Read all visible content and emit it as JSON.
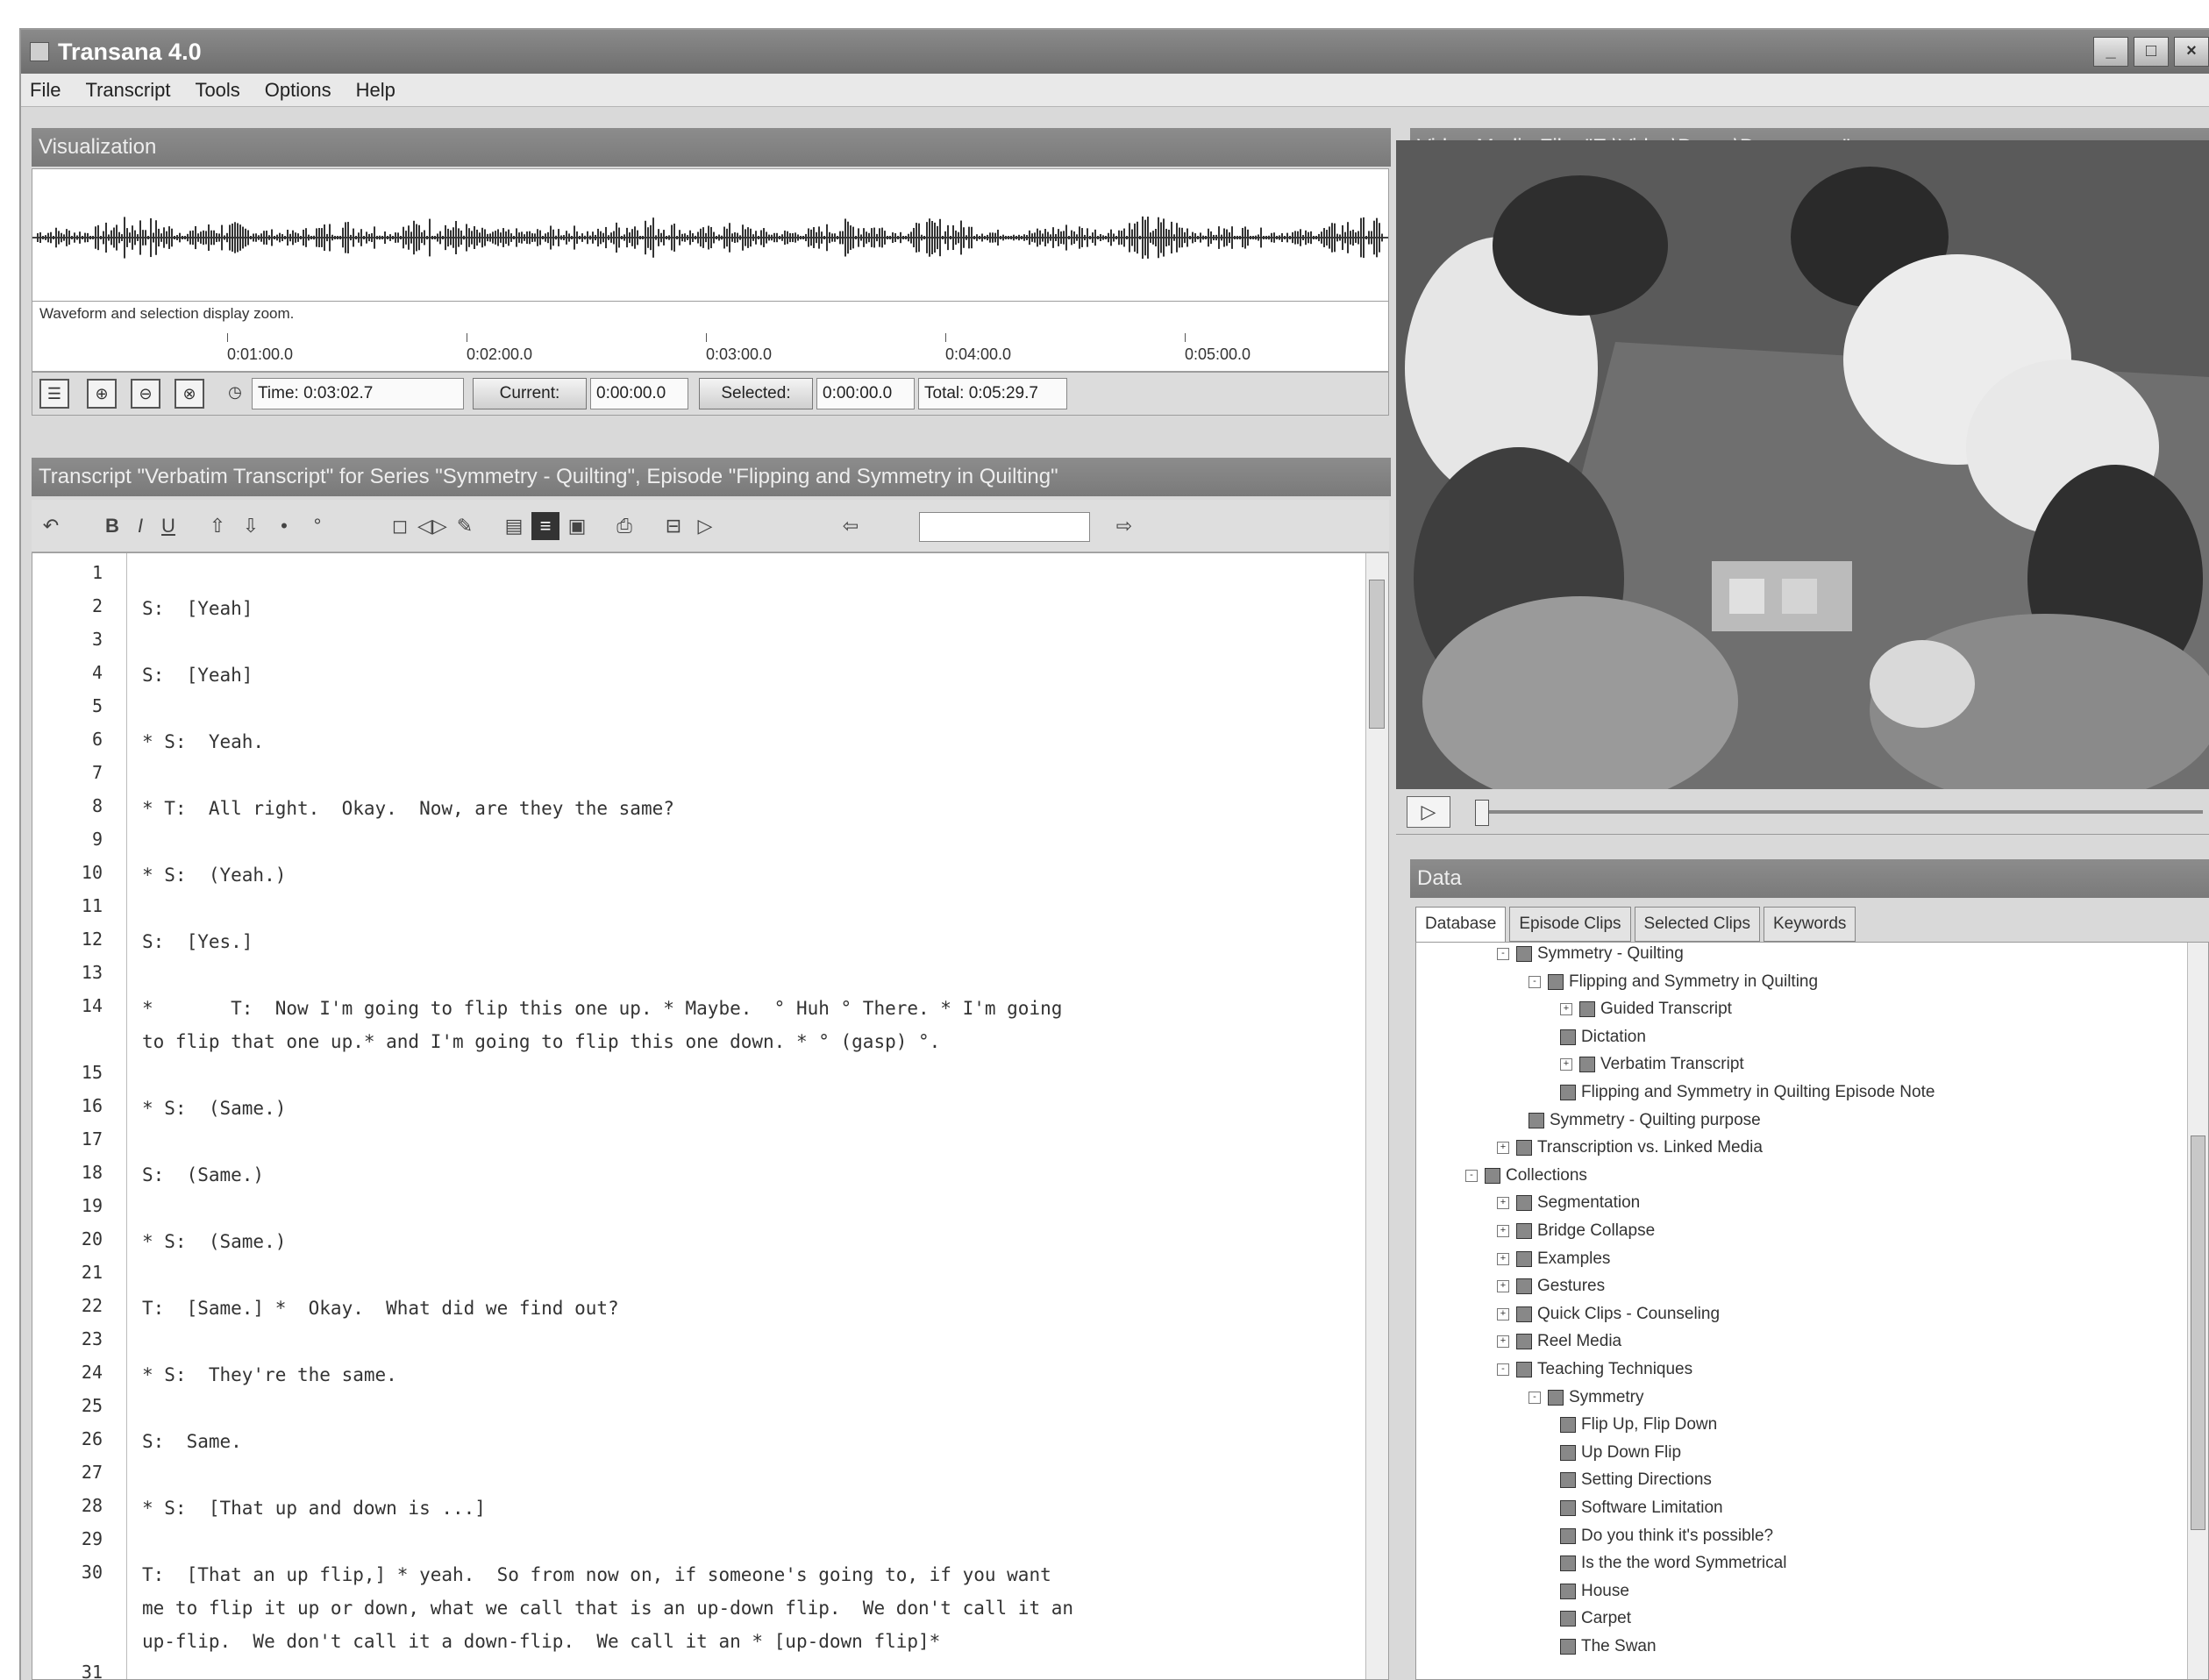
{
  "window": {
    "title": "Transana 4.0",
    "controls": [
      "_",
      "□",
      "×"
    ]
  },
  "menu": [
    "File",
    "Transcript",
    "Tools",
    "Options",
    "Help"
  ],
  "visualization": {
    "header": "Visualization",
    "caption": "Waveform and selection display zoom.",
    "ticks": [
      "0:01:00.0",
      "0:02:00.0",
      "0:03:00.0",
      "0:04:00.0",
      "0:05:00.0"
    ],
    "time_label": "Time: 0:03:02.7",
    "current_label": "Current:",
    "current_value": "0:00:00.0",
    "selected_label": "Selected:",
    "selected_value": "0:00:00.0",
    "total_label": "Total: 0:05:29.7"
  },
  "transcript": {
    "header": "Transcript \"Verbatim Transcript\" for Series \"Symmetry - Quilting\", Episode \"Flipping and Symmetry in Quilting\"",
    "toolbar_icons": [
      "undo-icon",
      "bold-icon",
      "italic-icon",
      "underline-icon",
      "rising-intonation-icon",
      "falling-intonation-icon",
      "audible-breath-icon",
      "whisper-icon",
      "timecode-icon",
      "toggle-timecodes-icon",
      "save-icon",
      "propagate-icon",
      "print-icon",
      "find-icon",
      "close-icon",
      "search-back-icon",
      "search-forward-icon"
    ],
    "lines": [
      {
        "n": "1",
        "t": ""
      },
      {
        "n": "2",
        "t": "S:  [Yeah]"
      },
      {
        "n": "3",
        "t": ""
      },
      {
        "n": "4",
        "t": "S:  [Yeah]"
      },
      {
        "n": "5",
        "t": ""
      },
      {
        "n": "6",
        "t": "* S:  Yeah."
      },
      {
        "n": "7",
        "t": ""
      },
      {
        "n": "8",
        "t": "* T:  All right.  Okay.  Now, are they the same?"
      },
      {
        "n": "9",
        "t": ""
      },
      {
        "n": "10",
        "t": "* S:  (Yeah.)"
      },
      {
        "n": "11",
        "t": ""
      },
      {
        "n": "12",
        "t": "S:  [Yes.]"
      },
      {
        "n": "13",
        "t": ""
      },
      {
        "n": "14",
        "t": "*       T:  Now I'm going to flip this one up. * Maybe.  ° Huh ° There. * I'm going\nto flip that one up.* and I'm going to flip this one down. * ° (gasp) °."
      },
      {
        "n": "15",
        "t": ""
      },
      {
        "n": "16",
        "t": "* S:  (Same.)"
      },
      {
        "n": "17",
        "t": ""
      },
      {
        "n": "18",
        "t": "S:  (Same.)"
      },
      {
        "n": "19",
        "t": ""
      },
      {
        "n": "20",
        "t": "* S:  (Same.)"
      },
      {
        "n": "21",
        "t": ""
      },
      {
        "n": "22",
        "t": "T:  [Same.] *  Okay.  What did we find out?"
      },
      {
        "n": "23",
        "t": ""
      },
      {
        "n": "24",
        "t": "* S:  They're the same."
      },
      {
        "n": "25",
        "t": ""
      },
      {
        "n": "26",
        "t": "S:  Same."
      },
      {
        "n": "27",
        "t": ""
      },
      {
        "n": "28",
        "t": "* S:  [That up and down is ...]"
      },
      {
        "n": "29",
        "t": ""
      },
      {
        "n": "30",
        "t": "T:  [That an up flip,] * yeah.  So from now on, if someone's going to, if you want\nme to flip it up or down, what we call that is an up-down flip.  We don't call it an\nup-flip.  We don't call it a down-flip.  We call it an * [up-down flip]*"
      },
      {
        "n": "31",
        "t": ""
      }
    ]
  },
  "video": {
    "header": "Video Media File: \"E:\\Video\\Demo\\Demo.mpg\"",
    "play_label": "▷"
  },
  "data": {
    "header": "Data",
    "tabs": [
      "Database",
      "Episode Clips",
      "Selected Clips",
      "Keywords"
    ],
    "tree": [
      {
        "label": "Symmetry - Quilting",
        "level": 0,
        "exp": "-",
        "icon": "series-icon"
      },
      {
        "label": "Flipping and Symmetry in Quilting",
        "level": 1,
        "exp": "-",
        "icon": "episode-icon"
      },
      {
        "label": "Guided Transcript",
        "level": 2,
        "exp": "+",
        "icon": "transcript-icon"
      },
      {
        "label": "Dictation",
        "level": 2,
        "exp": "",
        "icon": "transcript-icon"
      },
      {
        "label": "Verbatim Transcript",
        "level": 2,
        "exp": "+",
        "icon": "transcript-icon"
      },
      {
        "label": "Flipping and Symmetry in Quilting Episode Note",
        "level": 2,
        "exp": "",
        "icon": "note-icon"
      },
      {
        "label": "Symmetry - Quilting purpose",
        "level": 1,
        "exp": "",
        "icon": "note-icon"
      },
      {
        "label": "Transcription vs. Linked Media",
        "level": 0,
        "exp": "+",
        "icon": "series-icon"
      },
      {
        "label": "Collections",
        "level": -1,
        "exp": "-",
        "icon": "collections-icon"
      },
      {
        "label": "Segmentation",
        "level": 0,
        "exp": "+",
        "icon": "collection-icon"
      },
      {
        "label": "Bridge Collapse",
        "level": 0,
        "exp": "+",
        "icon": "collection-icon"
      },
      {
        "label": "Examples",
        "level": 0,
        "exp": "+",
        "icon": "collection-icon"
      },
      {
        "label": "Gestures",
        "level": 0,
        "exp": "+",
        "icon": "collection-icon"
      },
      {
        "label": "Quick Clips - Counseling",
        "level": 0,
        "exp": "+",
        "icon": "collection-icon"
      },
      {
        "label": "Reel Media",
        "level": 0,
        "exp": "+",
        "icon": "collection-icon"
      },
      {
        "label": "Teaching Techniques",
        "level": 0,
        "exp": "-",
        "icon": "collection-icon"
      },
      {
        "label": "Symmetry",
        "level": 1,
        "exp": "-",
        "icon": "collection-icon"
      },
      {
        "label": "Flip Up, Flip Down",
        "level": 2,
        "exp": "",
        "icon": "clip-icon"
      },
      {
        "label": "Up Down Flip",
        "level": 2,
        "exp": "",
        "icon": "clip-icon"
      },
      {
        "label": "Setting Directions",
        "level": 2,
        "exp": "",
        "icon": "clip-icon"
      },
      {
        "label": "Software Limitation",
        "level": 2,
        "exp": "",
        "icon": "clip-icon"
      },
      {
        "label": "Do you think it's possible?",
        "level": 2,
        "exp": "",
        "icon": "clip-icon"
      },
      {
        "label": "Is the the word Symmetrical",
        "level": 2,
        "exp": "",
        "icon": "clip-icon"
      },
      {
        "label": "House",
        "level": 2,
        "exp": "",
        "icon": "clip-icon"
      },
      {
        "label": "Carpet",
        "level": 2,
        "exp": "",
        "icon": "clip-icon"
      },
      {
        "label": "The Swan",
        "level": 2,
        "exp": "",
        "icon": "clip-icon"
      }
    ]
  }
}
